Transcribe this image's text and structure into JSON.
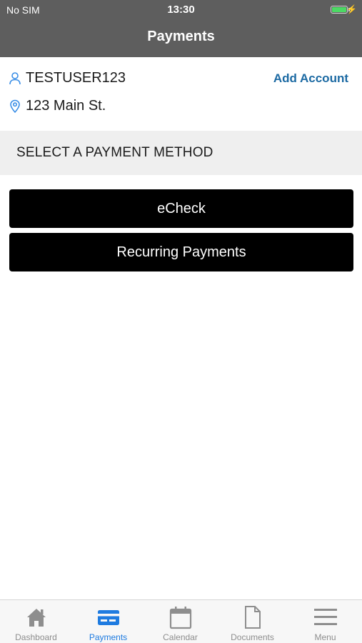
{
  "status_bar": {
    "carrier": "No SIM",
    "time": "13:30",
    "bolt": "⚡"
  },
  "nav": {
    "title": "Payments"
  },
  "account": {
    "username": "TESTUSER123",
    "address": "123 Main St.",
    "add_account_label": "Add Account"
  },
  "section": {
    "title": "SELECT A PAYMENT METHOD"
  },
  "payment_methods": {
    "echeck_label": "eCheck",
    "recurring_label": "Recurring Payments"
  },
  "tabbar": {
    "active": "payments",
    "items": [
      {
        "label": "Dashboard",
        "icon": "home-icon"
      },
      {
        "label": "Payments",
        "icon": "credit-card-icon"
      },
      {
        "label": "Calendar",
        "icon": "calendar-icon"
      },
      {
        "label": "Documents",
        "icon": "document-icon"
      },
      {
        "label": "Menu",
        "icon": "hamburger-menu-icon"
      }
    ]
  },
  "colors": {
    "header_bg": "#5e5e5e",
    "accent_link": "#1c6aa3",
    "tab_active": "#1e7be0",
    "tab_inactive": "#8e8e8e",
    "button_bg": "#000000",
    "battery_green": "#4cd964"
  }
}
